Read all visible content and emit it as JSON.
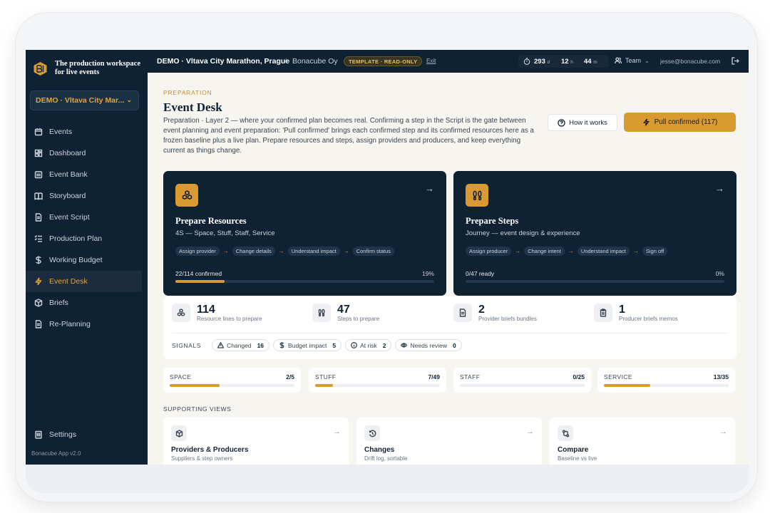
{
  "brand": {
    "tagline": "The production workspace for live events"
  },
  "event_selector": {
    "value": "DEMO · Vltava City Mar..."
  },
  "nav": [
    {
      "label": "Events",
      "icon": "calendar-icon"
    },
    {
      "label": "Dashboard",
      "icon": "dashboard-icon"
    },
    {
      "label": "Event Bank",
      "icon": "bank-icon"
    },
    {
      "label": "Storyboard",
      "icon": "book-icon"
    },
    {
      "label": "Event Script",
      "icon": "document-icon"
    },
    {
      "label": "Production Plan",
      "icon": "checklist-icon"
    },
    {
      "label": "Working Budget",
      "icon": "dollar-icon"
    },
    {
      "label": "Event Desk",
      "icon": "lightning-icon",
      "active": true
    },
    {
      "label": "Briefs",
      "icon": "box-icon"
    },
    {
      "label": "Re-Planning",
      "icon": "document-icon"
    }
  ],
  "settings_label": "Settings",
  "version": "Bonacube App v2.0",
  "topbar": {
    "title": "DEMO · Vltava City Marathon, Prague",
    "separator": "/",
    "org": "Bonacube Oy",
    "badge": "TEMPLATE · READ-ONLY",
    "exit": "Exit",
    "countdown": {
      "days": "293",
      "days_unit": "d",
      "hours": "12",
      "hours_unit": "h",
      "minutes": "44",
      "minutes_unit": "m"
    },
    "team": "Team",
    "email": "jesse@bonacube.com"
  },
  "page": {
    "eyebrow": "PREPARATION",
    "title": "Event Desk",
    "description": "Preparation · Layer 2 — where your confirmed plan becomes real. Confirming a step in the Script is the gate between event planning and event preparation: 'Pull confirmed' brings each confirmed step and its confirmed resources here as a frozen baseline plus a live plan. Prepare resources and steps, assign providers and producers, and keep everything current as things change.",
    "how_button": "How it works",
    "pull_button": "Pull confirmed (117)"
  },
  "cards": {
    "resources": {
      "title": "Prepare Resources",
      "subtitle": "4S — Space, Stuff, Staff, Service",
      "steps": [
        "Assign provider",
        "Change details",
        "Understand impact",
        "Confirm status"
      ],
      "progress_label": "22/114 confirmed",
      "progress_pct": "19%",
      "progress_value": 0.19
    },
    "steps": {
      "title": "Prepare Steps",
      "subtitle": "Journey — event design & experience",
      "steps": [
        "Assign producer",
        "Change intent",
        "Understand impact",
        "Sign off"
      ],
      "progress_label": "0/47 ready",
      "progress_pct": "0%",
      "progress_value": 0
    }
  },
  "stats": [
    {
      "value": "114",
      "label": "Resource lines to prepare"
    },
    {
      "value": "47",
      "label": "Steps to prepare"
    },
    {
      "value": "2",
      "label": "Provider briefs bundles"
    },
    {
      "value": "1",
      "label": "Producer briefs memos"
    }
  ],
  "signals": {
    "label": "SIGNALS",
    "items": [
      {
        "label": "Changed",
        "count": "16"
      },
      {
        "label": "Budget impact",
        "count": "5"
      },
      {
        "label": "At risk",
        "count": "2"
      },
      {
        "label": "Needs review",
        "count": "0"
      }
    ]
  },
  "categories": [
    {
      "name": "SPACE",
      "count": "2/5",
      "progress": 0.4
    },
    {
      "name": "STUFF",
      "count": "7/49",
      "progress": 0.143
    },
    {
      "name": "STAFF",
      "count": "0/25",
      "progress": 0
    },
    {
      "name": "SERVICE",
      "count": "13/35",
      "progress": 0.371
    }
  ],
  "supporting": {
    "label": "SUPPORTING VIEWS",
    "items": [
      {
        "title": "Providers & Producers",
        "subtitle": "Suppliers & step owners"
      },
      {
        "title": "Changes",
        "subtitle": "Drift log, sortable"
      },
      {
        "title": "Compare",
        "subtitle": "Baseline vs live"
      }
    ]
  },
  "colors": {
    "navy": "#0f2233",
    "accent": "#d99a32",
    "page_bg": "#f7f5f0"
  }
}
